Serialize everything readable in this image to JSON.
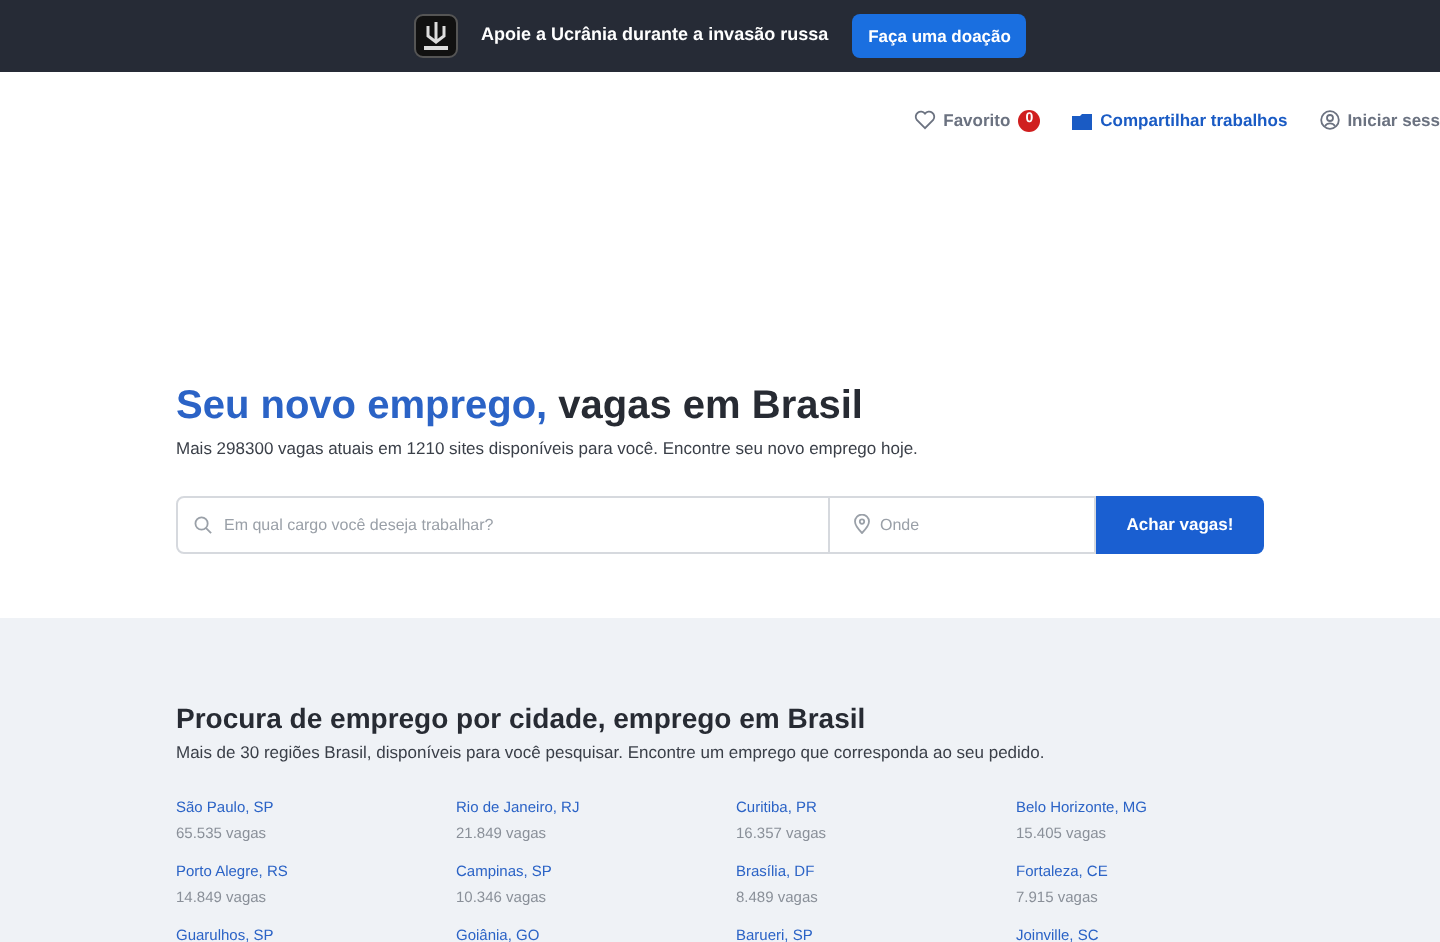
{
  "banner": {
    "text": "Apoie a Ucrânia durante a invasão russa",
    "button": "Faça uma doação"
  },
  "nav": {
    "favorites": {
      "label": "Favorito",
      "count": "0"
    },
    "share": "Compartilhar trabalhos",
    "login": "Iniciar sess"
  },
  "hero": {
    "title_highlight": "Seu novo emprego,",
    "title_rest": "vagas em Brasil",
    "subtitle": "Mais 298300 vagas atuais em 1210 sites disponíveis para você. Encontre seu novo emprego hoje.",
    "search": {
      "placeholder": "Em qual cargo você deseja trabalhar?"
    },
    "location": {
      "placeholder": "Onde"
    },
    "button": "Achar vagas!"
  },
  "cities": {
    "title": "Procura de emprego por cidade, emprego em Brasil",
    "subtitle": "Mais de 30 regiões Brasil, disponíveis para você pesquisar. Encontre um emprego que corresponda ao seu pedido.",
    "items": [
      {
        "name": "São Paulo, SP",
        "count": "65.535 vagas"
      },
      {
        "name": "Rio de Janeiro, RJ",
        "count": "21.849 vagas"
      },
      {
        "name": "Curitiba, PR",
        "count": "16.357 vagas"
      },
      {
        "name": "Belo Horizonte, MG",
        "count": "15.405 vagas"
      },
      {
        "name": "Porto Alegre, RS",
        "count": "14.849 vagas"
      },
      {
        "name": "Campinas, SP",
        "count": "10.346 vagas"
      },
      {
        "name": "Brasília, DF",
        "count": "8.489 vagas"
      },
      {
        "name": "Fortaleza, CE",
        "count": "7.915 vagas"
      },
      {
        "name": "Guarulhos, SP"
      },
      {
        "name": "Goiânia, GO"
      },
      {
        "name": "Barueri, SP"
      },
      {
        "name": "Joinville, SC"
      }
    ]
  }
}
